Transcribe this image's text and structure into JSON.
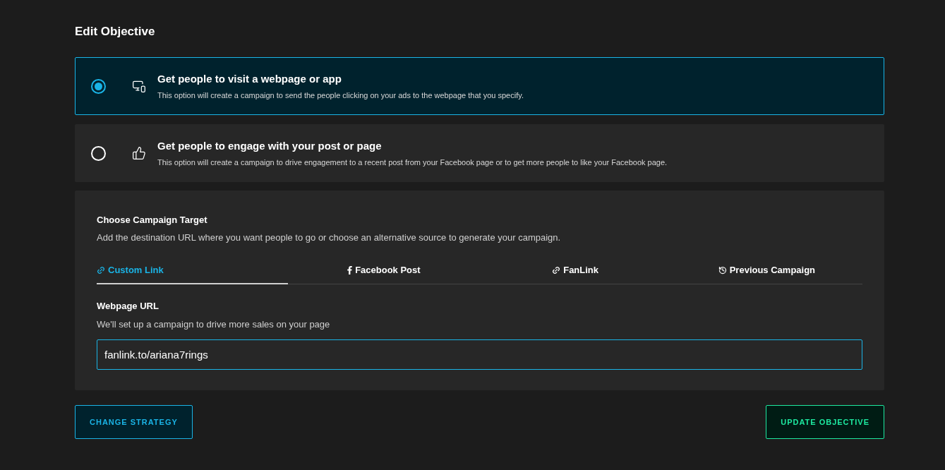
{
  "title": "Edit Objective",
  "options": [
    {
      "kind": "devices",
      "title": "Get people to visit a webpage or app",
      "description": "This option will create a campaign to send the people clicking on your ads to the webpage that you specify.",
      "selected": true
    },
    {
      "kind": "thumbs",
      "title": "Get people to engage with your post or page",
      "description": "This option will create a campaign to drive engagement to a recent post from your Facebook page or to get more people to like your Facebook page.",
      "selected": false
    }
  ],
  "target": {
    "heading": "Choose Campaign Target",
    "description": "Add the destination URL where you want people to go or choose an alternative source to generate your campaign.",
    "tabs": [
      {
        "kind": "link",
        "label": "Custom Link",
        "selected": true
      },
      {
        "kind": "facebook",
        "label": "Facebook Post",
        "selected": false
      },
      {
        "kind": "link",
        "label": "FanLink",
        "selected": false
      },
      {
        "kind": "history",
        "label": "Previous Campaign",
        "selected": false
      }
    ],
    "field": {
      "label": "Webpage URL",
      "hint": "We'll set up a campaign to drive more sales on your page",
      "value": "fanlink.to/ariana7rings"
    }
  },
  "buttons": [
    {
      "kind": "secondary",
      "label": "CHANGE STRATEGY"
    },
    {
      "kind": "primary",
      "label": "UPDATE OBJECTIVE"
    }
  ]
}
